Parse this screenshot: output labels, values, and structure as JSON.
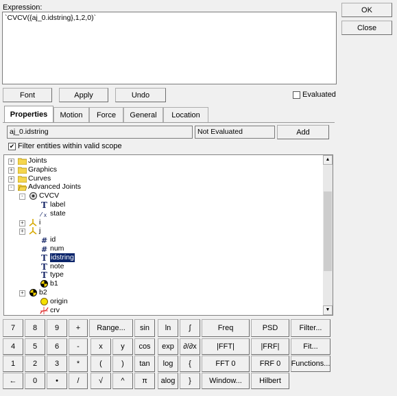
{
  "expression": {
    "label": "Expression:",
    "value": "`CVCV({aj_0.idstring},1,2,0)`"
  },
  "side_buttons": {
    "ok": "OK",
    "close": "Close"
  },
  "toolbar": {
    "font": "Font",
    "apply": "Apply",
    "undo": "Undo",
    "evaluated": "Evaluated"
  },
  "tabs": [
    "Properties",
    "Motion",
    "Force",
    "General",
    "Location"
  ],
  "entity": {
    "value": "aj_0.idstring",
    "status": "Not Evaluated",
    "add": "Add"
  },
  "filter": {
    "label": "Filter entities within valid scope",
    "checked": true
  },
  "tree": [
    {
      "label": "Joints",
      "icon": "folder-icon",
      "expander": "+"
    },
    {
      "label": "Graphics",
      "icon": "folder-icon",
      "expander": "+"
    },
    {
      "label": "Curves",
      "icon": "folder-icon",
      "expander": "+"
    },
    {
      "label": "Advanced Joints",
      "icon": "open-folder-icon",
      "expander": "-"
    },
    {
      "label": "CVCV",
      "icon": "joint-icon",
      "expander": "-"
    },
    {
      "label": "label",
      "icon": "text-T-icon"
    },
    {
      "label": "state",
      "icon": "state-icon"
    },
    {
      "label": "i",
      "icon": "marker-icon",
      "expander": "+"
    },
    {
      "label": "j",
      "icon": "marker-icon",
      "expander": "+"
    },
    {
      "label": "id",
      "icon": "hash-icon"
    },
    {
      "label": "num",
      "icon": "hash-icon"
    },
    {
      "label": "idstring",
      "icon": "text-T-icon",
      "selected": true
    },
    {
      "label": "note",
      "icon": "text-T-icon"
    },
    {
      "label": "type",
      "icon": "text-T-icon"
    },
    {
      "label": "b1",
      "icon": "body-icon"
    },
    {
      "label": "b2",
      "icon": "body-icon",
      "expander": "+"
    },
    {
      "label": "origin",
      "icon": "point-icon"
    },
    {
      "label": "crv",
      "icon": "curve-icon"
    }
  ],
  "keypad": {
    "row1": [
      "7",
      "8",
      "9",
      "+",
      "Range...",
      "sin",
      "ln",
      "∫",
      "Freq",
      "PSD",
      "Filter..."
    ],
    "row2": [
      "4",
      "5",
      "6",
      "-",
      "x",
      "y",
      "cos",
      "exp",
      "∂/∂x",
      "|FFT|",
      "|FRF|",
      "Fit..."
    ],
    "row3": [
      "1",
      "2",
      "3",
      "*",
      "(",
      ")",
      "tan",
      "log",
      "{",
      "FFT 0",
      "FRF 0",
      "Functions..."
    ],
    "row4": [
      "←",
      "0",
      "•",
      "/",
      "√",
      "^",
      "π",
      "alog",
      "}",
      "Window...",
      "Hilbert"
    ]
  },
  "colors": {
    "selection": "#0a246a",
    "folder": "#f5d64e",
    "body": "#f0d000"
  }
}
